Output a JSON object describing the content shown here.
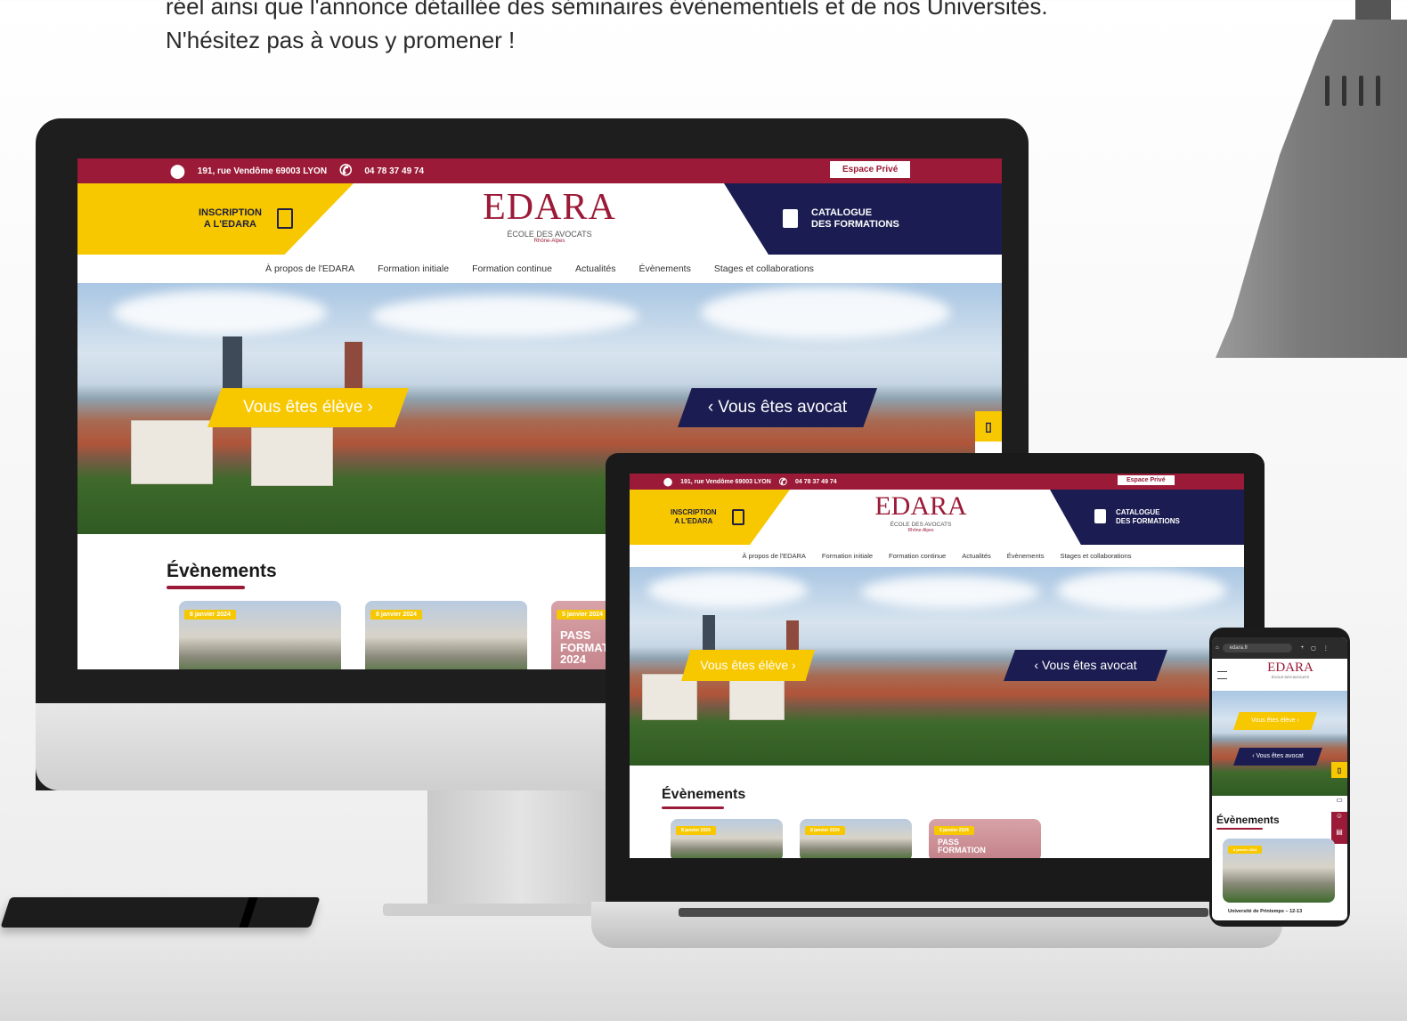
{
  "intro": {
    "line1": "réel ainsi que l'annonce détaillée des séminaires évènementiels et de nos Universités.",
    "line2": "N'hésitez pas à vous y promener !"
  },
  "site": {
    "address": "191, rue Vendôme 69003 LYON",
    "phone": "04 78 37 49 74",
    "private_space": "Espace Privé",
    "inscription_line1": "INSCRIPTION",
    "inscription_line2": "A L'EDARA",
    "catalogue_line1": "CATALOGUE",
    "catalogue_line2": "DES FORMATIONS",
    "logo": "EDARA",
    "logo_sub": "ÉCOLE DES AVOCATS",
    "logo_region": "Rhône-Alpes",
    "nav": [
      "À propos de l'EDARA",
      "Formation initiale",
      "Formation continue",
      "Actualités",
      "Évènements",
      "Stages et collaborations"
    ],
    "cta_student": "Vous êtes élève ›",
    "cta_lawyer": "‹ Vous êtes avocat",
    "events_title": "Évènements",
    "card_dates": [
      "8 janvier 2024",
      "8 janvier 2024",
      "5 janvier 2024"
    ],
    "pass_line1": "PASS",
    "pass_line2": "FORMATION",
    "pass_line3": "2024"
  },
  "phone": {
    "url": "edara.fr",
    "card_caption": "Université de Printemps – 12-13",
    "card_date": "8 janvier 2024"
  },
  "colors": {
    "burgundy": "#9b1a37",
    "yellow": "#f7c700",
    "navy": "#1b1d52"
  },
  "icons": {
    "pin": "map-pin-icon",
    "phone": "phone-icon",
    "document": "document-icon",
    "book": "book-icon",
    "calendar": "calendar-icon",
    "menu": "hamburger-menu-icon"
  }
}
